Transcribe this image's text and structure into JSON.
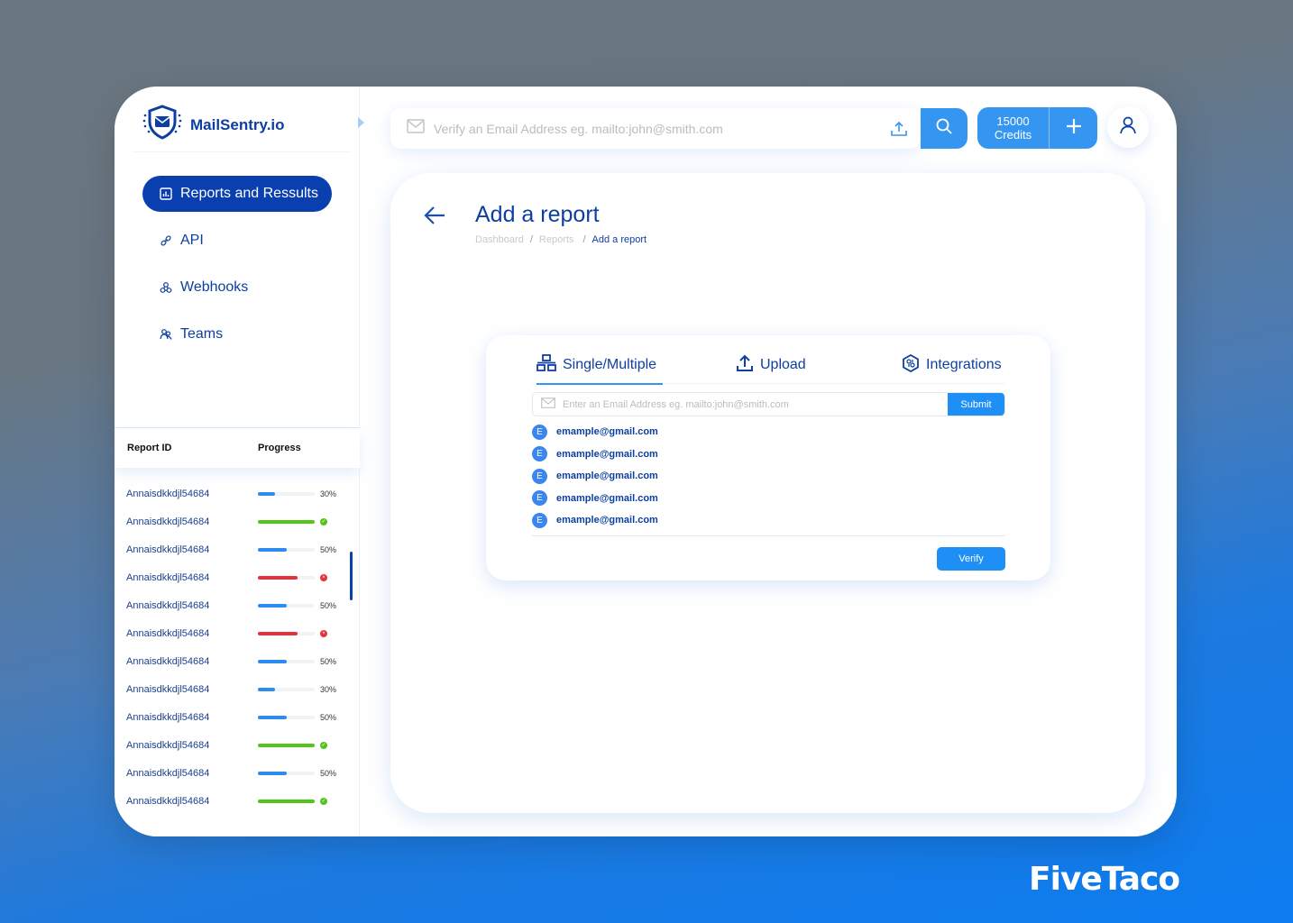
{
  "app": {
    "name": "MailSentry.io"
  },
  "sidebar": {
    "items": [
      {
        "label": "Reports and Ressults",
        "icon": "bar-chart-icon",
        "active": true
      },
      {
        "label": "API",
        "icon": "link-icon",
        "active": false
      },
      {
        "label": "Webhooks",
        "icon": "webhook-icon",
        "active": false
      },
      {
        "label": "Teams",
        "icon": "users-icon",
        "active": false
      }
    ],
    "report_table": {
      "headers": {
        "id": "Report ID",
        "progress": "Progress"
      },
      "rows": [
        {
          "id": "Annaisdkkdjl54684",
          "progress": 30,
          "status": "in-progress",
          "label": "30%"
        },
        {
          "id": "Annaisdkkdjl54684",
          "progress": 100,
          "status": "complete",
          "label": ""
        },
        {
          "id": "Annaisdkkdjl54684",
          "progress": 50,
          "status": "in-progress",
          "label": "50%"
        },
        {
          "id": "Annaisdkkdjl54684",
          "progress": 70,
          "status": "failed",
          "label": ""
        },
        {
          "id": "Annaisdkkdjl54684",
          "progress": 50,
          "status": "in-progress",
          "label": "50%"
        },
        {
          "id": "Annaisdkkdjl54684",
          "progress": 70,
          "status": "failed",
          "label": ""
        },
        {
          "id": "Annaisdkkdjl54684",
          "progress": 50,
          "status": "in-progress",
          "label": "50%"
        },
        {
          "id": "Annaisdkkdjl54684",
          "progress": 30,
          "status": "in-progress",
          "label": "30%"
        },
        {
          "id": "Annaisdkkdjl54684",
          "progress": 50,
          "status": "in-progress",
          "label": "50%"
        },
        {
          "id": "Annaisdkkdjl54684",
          "progress": 100,
          "status": "complete",
          "label": ""
        },
        {
          "id": "Annaisdkkdjl54684",
          "progress": 50,
          "status": "in-progress",
          "label": "50%"
        },
        {
          "id": "Annaisdkkdjl54684",
          "progress": 100,
          "status": "complete",
          "label": ""
        }
      ]
    }
  },
  "topbar": {
    "search_placeholder": "Verify an Email Address eg. mailto:john@smith.com",
    "credits_value": "15000",
    "credits_label": "Credits"
  },
  "main": {
    "title": "Add a report",
    "breadcrumb": [
      "Dashboard",
      "Reports",
      "Add a report"
    ],
    "tabs": [
      {
        "label": "Single/Multiple",
        "active": true
      },
      {
        "label": "Upload",
        "active": false
      },
      {
        "label": "Integrations",
        "active": false
      }
    ],
    "email_input_placeholder": "Enter an Email Address eg. mailto:john@smith.com",
    "submit_label": "Submit",
    "emails": [
      {
        "badge": "E",
        "address": "emample@gmail.com"
      },
      {
        "badge": "E",
        "address": "emample@gmail.com"
      },
      {
        "badge": "E",
        "address": "emample@gmail.com"
      },
      {
        "badge": "E",
        "address": "emample@gmail.com"
      },
      {
        "badge": "E",
        "address": "emample@gmail.com"
      }
    ],
    "verify_label": "Verify"
  },
  "colors": {
    "primary": "#0d3fa0",
    "accent": "#3596f2",
    "in_progress": "#2d8cf0",
    "complete": "#52c41a",
    "failed": "#e8303a"
  },
  "brand": "FiveTaco"
}
